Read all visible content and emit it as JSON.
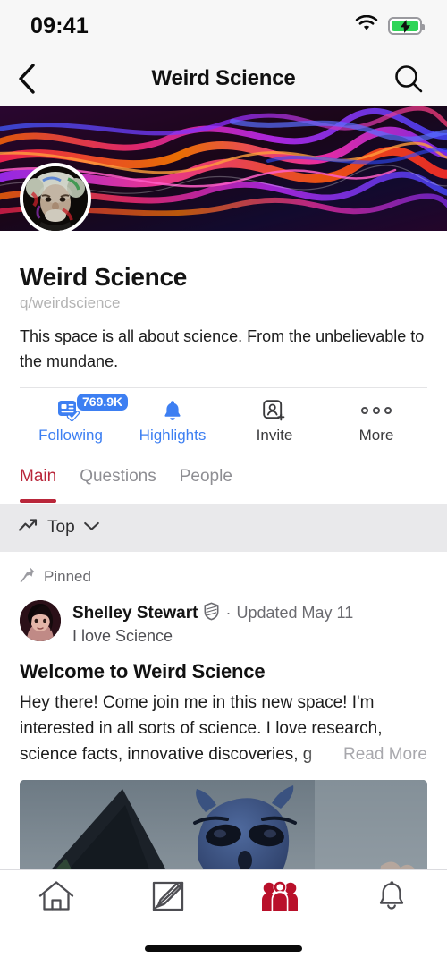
{
  "statusbar": {
    "time": "09:41",
    "wifi_icon": "wifi-icon",
    "battery_icon": "battery-charging-icon",
    "battery_bolt": "⚡"
  },
  "navbar": {
    "back_icon": "chevron-left-icon",
    "title": "Weird Science",
    "search_icon": "search-icon"
  },
  "profile": {
    "banner_name": "space-banner",
    "avatar_name": "space-avatar",
    "name": "Weird Science",
    "handle": "q/weirdscience",
    "description": "This space is all about science. From the unbelievable to the mundane."
  },
  "actions": [
    {
      "label": "Following",
      "icon": "following-check-icon",
      "badge": "769.9K",
      "accent": true
    },
    {
      "label": "Highlights",
      "icon": "bell-filled-icon",
      "badge": null,
      "accent": true
    },
    {
      "label": "Invite",
      "icon": "person-add-icon",
      "badge": null,
      "accent": false
    },
    {
      "label": "More",
      "icon": "more-dots-icon",
      "badge": null,
      "accent": false
    }
  ],
  "tabs": [
    {
      "label": "Main",
      "active": true
    },
    {
      "label": "Questions",
      "active": false
    },
    {
      "label": "People",
      "active": false
    }
  ],
  "sortbar": {
    "icon": "trending-up-icon",
    "label": "Top",
    "chevron_icon": "chevron-down-icon"
  },
  "post": {
    "pinned_icon": "pin-icon",
    "pinned_label": "Pinned",
    "author_avatar": "author-avatar",
    "author": "Shelley Stewart",
    "badge_icon": "moderator-shield-icon",
    "separator": "·",
    "timestamp": "Updated May 11",
    "subtitle": "I love Science",
    "title": "Welcome to Weird Science",
    "body": "Hey there! Come join me in this new space! I'm interested in all sorts of science. I love research, science facts, innovative discoveries, g",
    "read_more": "Read More",
    "media_name": "post-image-alien"
  },
  "tabbar": [
    {
      "icon": "home-icon",
      "active": false
    },
    {
      "icon": "compose-icon",
      "active": false
    },
    {
      "icon": "spaces-group-icon",
      "active": true
    },
    {
      "icon": "notifications-bell-icon",
      "active": false
    }
  ],
  "colors": {
    "accent_blue": "#3d7ff2",
    "accent_crimson": "#b9263a",
    "battery_green": "#2fd557",
    "sortbar_gray": "#e9e9eb"
  }
}
